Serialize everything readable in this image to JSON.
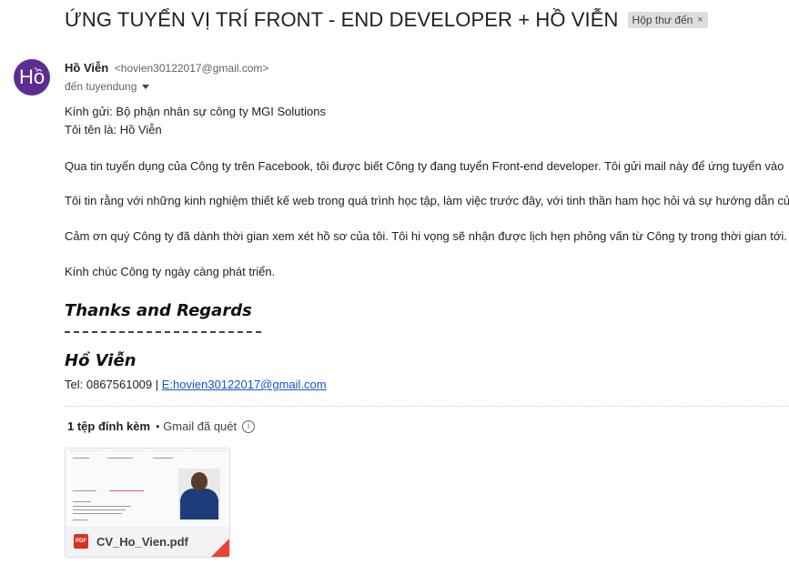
{
  "email": {
    "subject": "ỨNG TUYỂN VỊ TRÍ FRONT - END DEVELOPER + HỒ VIỄN",
    "label": "Hộp thư đến",
    "label_close": "×",
    "avatar_text": "Hồ",
    "sender_name": "Hồ Viễn",
    "sender_email": "<hovien30122017@gmail.com>",
    "recipient": "đến tuyendung",
    "body": {
      "greeting": "Kính gửi: Bộ phận nhân sự công ty MGI Solutions",
      "intro": "Tôi tên là: Hồ Viễn",
      "p1": "Qua tin tuyển dụng của Công ty trên Facebook, tôi được biết Công ty đang tuyển  Front-end developer. Tôi gửi mail này để ứng tuyển vào",
      "p2": "Tôi tin rằng với những kinh nghiệm thiết kế web trong quá trình học tập, làm việc trước đây, với tinh thần ham học hỏi và sự hướng dẫn củ",
      "p3": "Cảm ơn quý Công ty đã dành thời gian xem xét hồ sơ của tôi. Tôi hi vọng sẽ nhận được lịch hẹn phỏng vấn từ Công ty trong thời gian tới.",
      "p4": "Kính chúc Công ty ngày càng phát triển."
    },
    "signature": {
      "title": "Thanks and Regards",
      "name": "Hồ Viễn",
      "tel": "Tel: 0867561009 | ",
      "email_link": "E:hovien30122017@gmail.com"
    },
    "attachments": {
      "count_label": "1 tệp đính kèm",
      "scan_label": "• Gmail đã quét",
      "files": [
        {
          "name": "CV_Ho_Vien.pdf",
          "type_label": "PDF"
        }
      ]
    }
  }
}
